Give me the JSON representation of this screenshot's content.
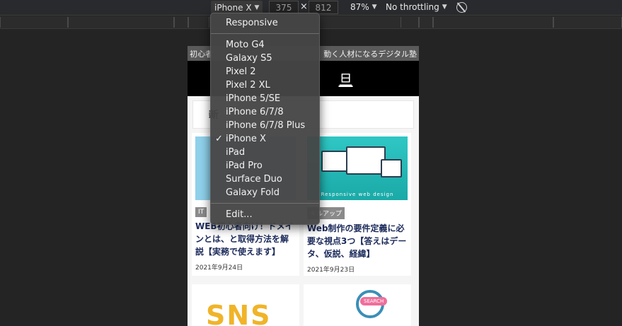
{
  "toolbar": {
    "device": "iPhone X",
    "width": "375",
    "height": "812",
    "times": "×",
    "zoom": "87%",
    "throttling": "No throttling"
  },
  "device_menu": {
    "responsive": "Responsive",
    "devices": [
      "Moto G4",
      "Galaxy S5",
      "Pixel 2",
      "Pixel 2 XL",
      "iPhone 5/SE",
      "iPhone 6/7/8",
      "iPhone 6/7/8 Plus",
      "iPhone X",
      "iPad",
      "iPad Pro",
      "Surface Duo",
      "Galaxy Fold"
    ],
    "selected": "iPhone X",
    "check": "✓",
    "edit": "Edit..."
  },
  "page": {
    "topbar_left": "初心者",
    "topbar_right": "動く人材になるデジタル塾",
    "header_tail": "旦",
    "new_label": "新",
    "cards": [
      {
        "category": "IT",
        "title": "WEB初心者向け！ドメインとは、と取得方法を解説【実務で使えます】",
        "date": "2021年9月24日"
      },
      {
        "category": "キルアップ",
        "title": "Web制作の要件定義に必要な視点3つ【答えはデータ、仮説、経緯】",
        "date": "2021年9月23日",
        "thumb_label": "Responsive web design"
      }
    ],
    "bottom_cards": [
      {
        "thumb_text": "SNS"
      },
      {
        "thumb_text": "SEARCH"
      }
    ]
  }
}
